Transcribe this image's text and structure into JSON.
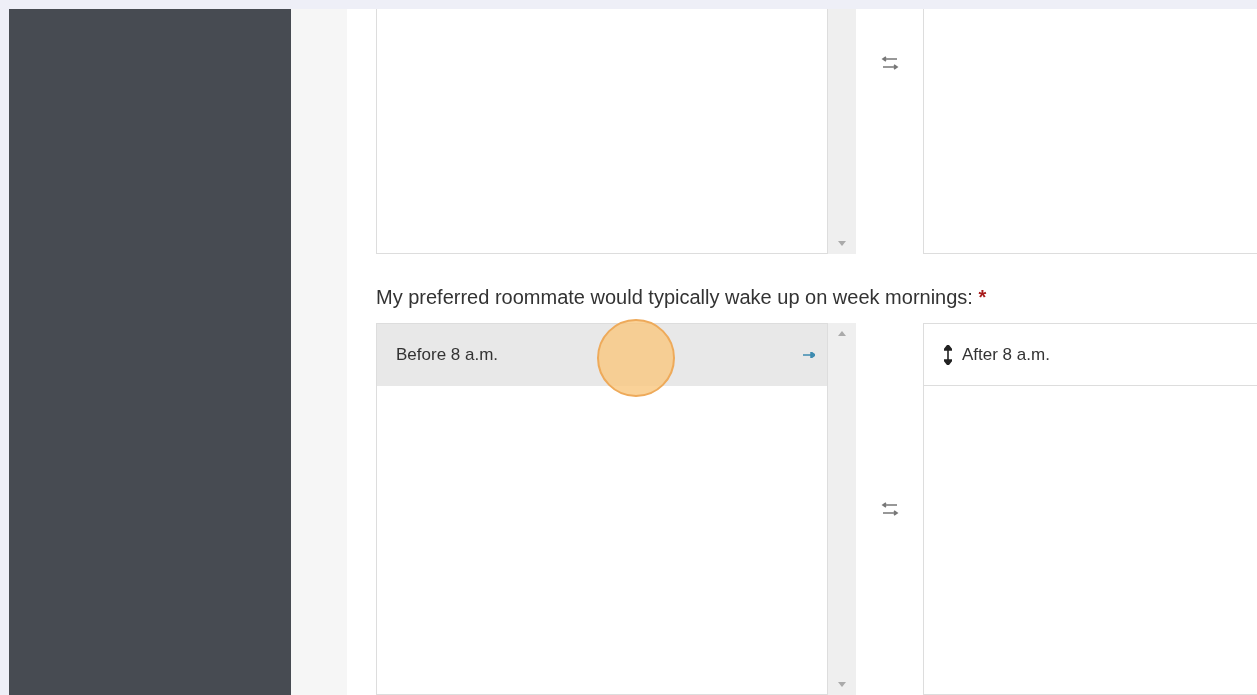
{
  "questions": [
    {
      "kind": "partial"
    },
    {
      "kind": "full",
      "label": "My preferred roommate would typically wake up on week mornings:",
      "required": true,
      "required_mark": "*",
      "available": [
        {
          "label": "Before 8 a.m.",
          "selected": true
        }
      ],
      "chosen": [
        {
          "label": "After 8 a.m.",
          "selected": false
        }
      ]
    }
  ]
}
